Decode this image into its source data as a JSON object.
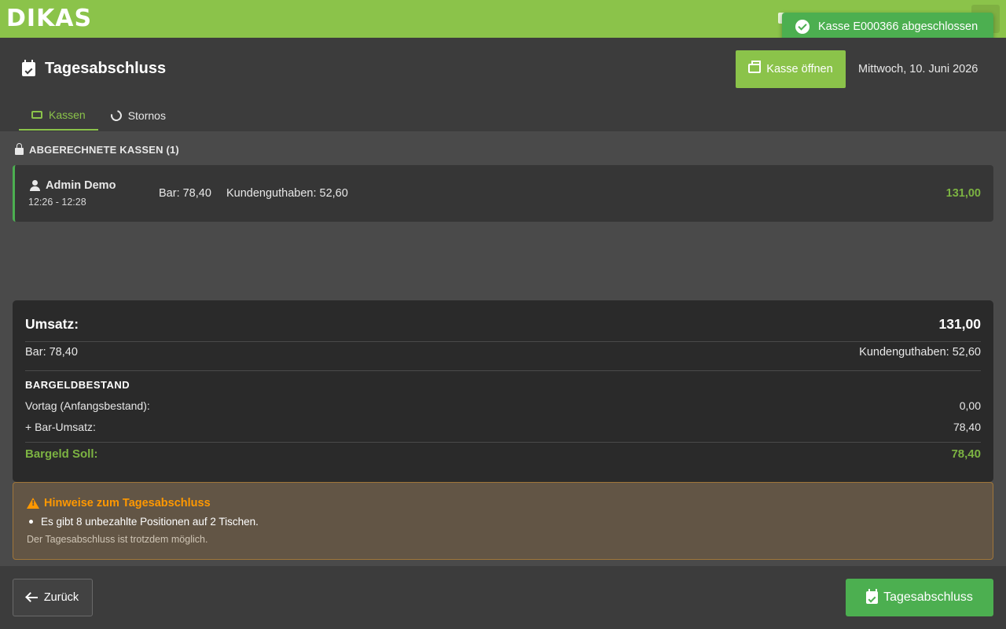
{
  "app": {
    "logo_text": "DIKAS"
  },
  "toast": {
    "message": "Kasse E000366 abgeschlossen"
  },
  "header": {
    "title": "Tagesabschluss",
    "open_register_label": "Kasse öffnen",
    "date": "Mittwoch, 10. Juni 2026",
    "tabs": [
      {
        "label": "Kassen",
        "active": true
      },
      {
        "label": "Stornos",
        "active": false
      }
    ]
  },
  "closed_registers": {
    "heading": "ABGERECHNETE KASSEN (1)",
    "items": [
      {
        "user": "Admin Demo",
        "time_range": "12:26 - 12:28",
        "cash": "Bar: 78,40",
        "credit": "Kundenguthaben: 52,60",
        "total": "131,00"
      }
    ]
  },
  "summary": {
    "revenue_label": "Umsatz:",
    "revenue_value": "131,00",
    "cash_text": "Bar: 78,40",
    "credit_text": "Kundenguthaben: 52,60",
    "cash_stock_heading": "BARGELDBESTAND",
    "opening_label": "Vortag (Anfangsbestand):",
    "opening_value": "0,00",
    "cash_sales_label": "+ Bar-Umsatz:",
    "cash_sales_value": "78,40",
    "expected_cash_label": "Bargeld Soll:",
    "expected_cash_value": "78,40"
  },
  "warning": {
    "title": "Hinweise zum Tagesabschluss",
    "items": [
      "Es gibt 8 unbezahlte Positionen auf 2 Tischen."
    ],
    "note": "Der Tagesabschluss ist trotzdem möglich."
  },
  "footer": {
    "back_label": "Zurück",
    "close_day_label": "Tagesabschluss"
  },
  "colors": {
    "brand_green": "#8bc34a",
    "success_green": "#4caf50",
    "warning_orange": "#ff9800"
  }
}
